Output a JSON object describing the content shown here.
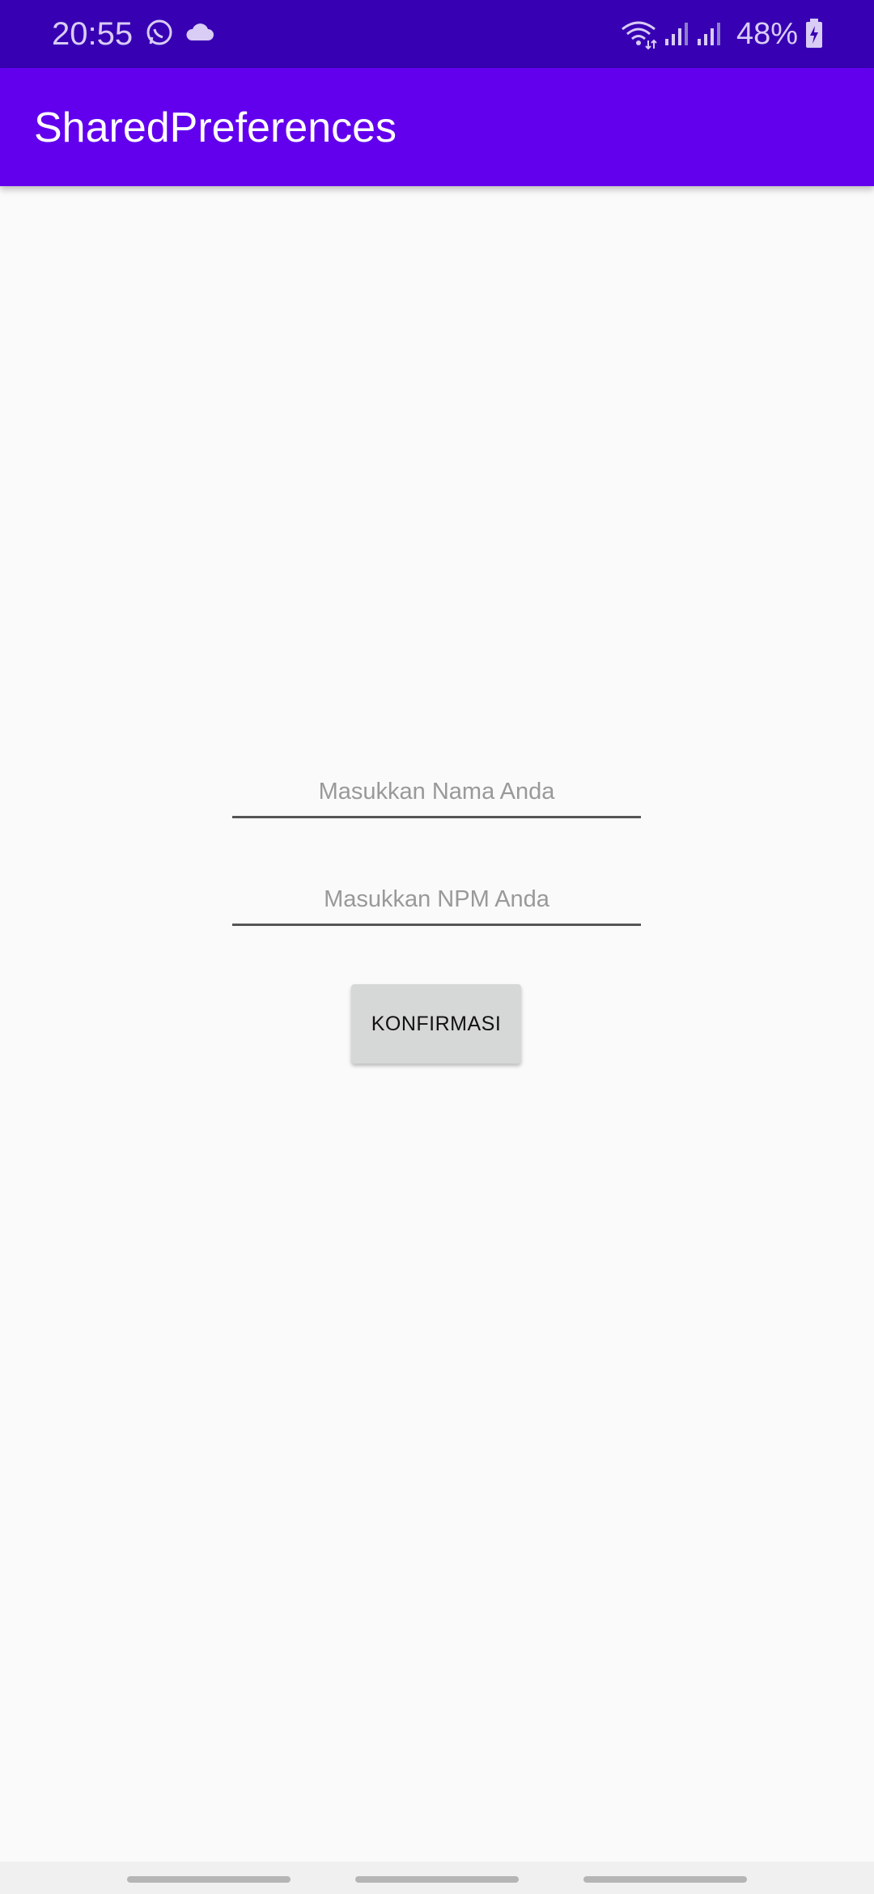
{
  "status_bar": {
    "time": "20:55",
    "battery_text": "48%",
    "icons": [
      "whatsapp-icon",
      "cloud-icon",
      "wifi-icon",
      "signal-icon",
      "signal-icon",
      "battery-charging-icon"
    ]
  },
  "app_bar": {
    "title": "SharedPreferences",
    "color": "#6200ee"
  },
  "form": {
    "name_placeholder": "Masukkan Nama Anda",
    "name_value": "",
    "npm_placeholder": "Masukkan NPM Anda",
    "npm_value": "",
    "confirm_label": "KONFIRMASI"
  },
  "colors": {
    "status_bar": "#3700b3",
    "app_bar": "#6200ee",
    "background": "#fafafa",
    "button": "#d6d7d7"
  }
}
